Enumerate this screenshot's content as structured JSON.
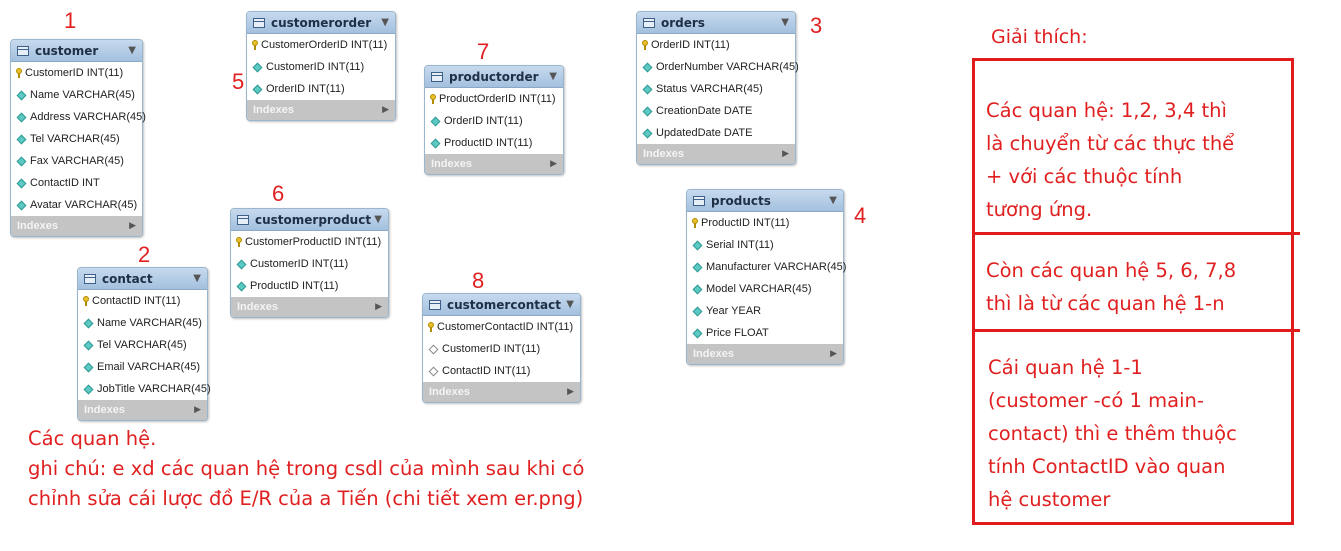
{
  "tables": {
    "customer": {
      "name": "customer",
      "columns": [
        "CustomerID INT(11)",
        "Name VARCHAR(45)",
        "Address VARCHAR(45)",
        "Tel VARCHAR(45)",
        "Fax VARCHAR(45)",
        "ContactID INT",
        "Avatar VARCHAR(45)"
      ],
      "indexes_label": "Indexes"
    },
    "customerorder": {
      "name": "customerorder",
      "columns": [
        "CustomerOrderID INT(11)",
        "CustomerID INT(11)",
        "OrderID INT(11)"
      ],
      "indexes_label": "Indexes"
    },
    "productorder": {
      "name": "productorder",
      "columns": [
        "ProductOrderID INT(11)",
        "OrderID INT(11)",
        "ProductID INT(11)"
      ],
      "indexes_label": "Indexes"
    },
    "orders": {
      "name": "orders",
      "columns": [
        "OrderID INT(11)",
        "OrderNumber VARCHAR(45)",
        "Status VARCHAR(45)",
        "CreationDate DATE",
        "UpdatedDate DATE"
      ],
      "indexes_label": "Indexes"
    },
    "products": {
      "name": "products",
      "columns": [
        "ProductID INT(11)",
        "Serial INT(11)",
        "Manufacturer VARCHAR(45)",
        "Model VARCHAR(45)",
        "Year YEAR",
        "Price FLOAT"
      ],
      "indexes_label": "Indexes"
    },
    "contact": {
      "name": "contact",
      "columns": [
        "ContactID INT(11)",
        "Name VARCHAR(45)",
        "Tel VARCHAR(45)",
        "Email VARCHAR(45)",
        "JobTitle VARCHAR(45)"
      ],
      "indexes_label": "Indexes"
    },
    "customerproduct": {
      "name": "customerproduct",
      "columns": [
        "CustomerProductID INT(11)",
        "CustomerID INT(11)",
        "ProductID INT(11)"
      ],
      "indexes_label": "Indexes"
    },
    "customercontact": {
      "name": "customercontact",
      "columns": [
        "CustomerContactID INT(11)",
        "CustomerID INT(11)",
        "ContactID INT(11)"
      ],
      "indexes_label": "Indexes"
    }
  },
  "numbers": {
    "n1": "1",
    "n2": "2",
    "n3": "3",
    "n4": "4",
    "n5": "5",
    "n6": "6",
    "n7": "7",
    "n8": "8"
  },
  "explanation": {
    "title": "Giải thích:",
    "section1": [
      "Các quan hệ: 1,2, 3,4 thì",
      "là chuyển từ các thực thể",
      "+ với các thuộc tính",
      "tương ứng."
    ],
    "section2": [
      "Còn các quan hệ 5, 6, 7,8",
      "thì là từ các quan hệ 1-n"
    ],
    "section3": [
      "Cái quan hệ 1-1",
      "(customer -có 1 main-",
      "contact) thì e thêm thuộc",
      "tính ContactID vào quan",
      "hệ customer"
    ]
  },
  "bottom_note": [
    "Các quan hệ.",
    "ghi chú: e xd các quan hệ trong csdl của mình sau khi có",
    "chỉnh sửa cái lược đồ E/R của a Tiến (chi tiết xem er.png)"
  ],
  "colors": {
    "annotation_red": "#e02020",
    "table_header": "#a3c0de",
    "indexes_bar": "#c4c4c4"
  }
}
